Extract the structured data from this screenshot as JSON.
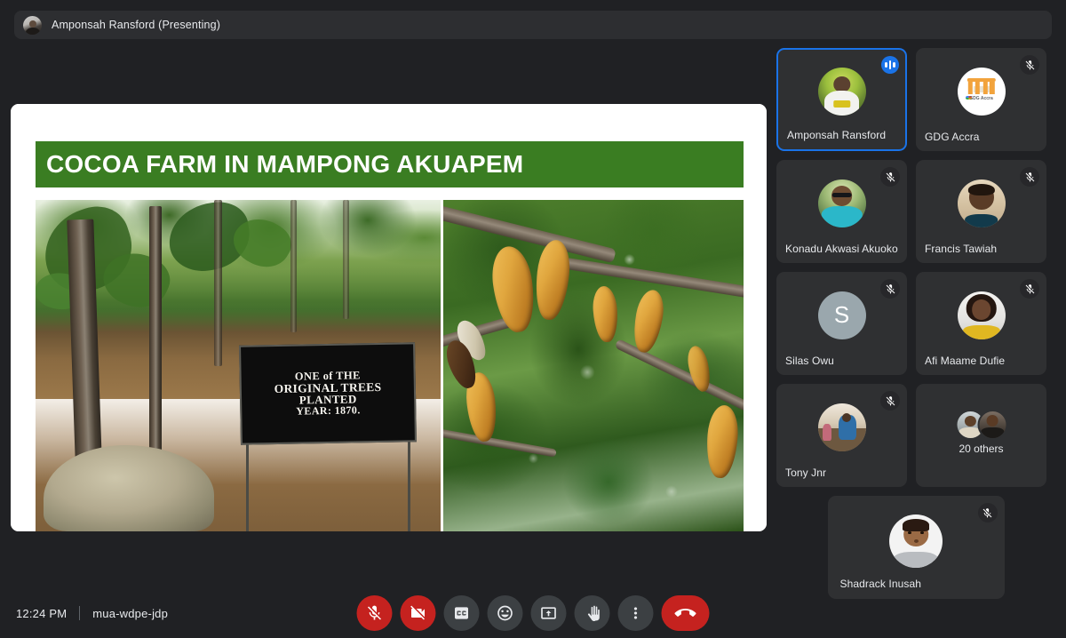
{
  "app": {
    "background_color": "#202124",
    "accent_color": "#1a73e8",
    "danger_color": "#c5221f"
  },
  "presenter_banner": {
    "label": "Amponsah Ransford (Presenting)",
    "avatar_name": "presenter-avatar"
  },
  "shared_screen": {
    "slide_title": "COCOA FARM IN MAMPONG AKUAPEM",
    "title_band_color": "#3a7d22",
    "photos": [
      {
        "name": "cocoa-farm-plaque-photo",
        "plaque_lines": [
          "ONE of THE",
          "ORIGINAL TREES",
          "PLANTED",
          "YEAR:  1870."
        ]
      },
      {
        "name": "cocoa-pods-photo",
        "description": "Cocoa pods on tree branches"
      }
    ]
  },
  "participants": [
    {
      "name": "Amponsah Ransford",
      "muted": false,
      "speaking": true,
      "active": true,
      "avatar": "av-ransford",
      "initial": ""
    },
    {
      "name": "GDG Accra",
      "muted": true,
      "speaking": false,
      "active": false,
      "avatar": "av-gdg",
      "initial": ""
    },
    {
      "name": "Konadu Akwasi Akuoko",
      "muted": true,
      "speaking": false,
      "active": false,
      "avatar": "av-konadu",
      "initial": ""
    },
    {
      "name": "Francis Tawiah",
      "muted": true,
      "speaking": false,
      "active": false,
      "avatar": "av-francis",
      "initial": ""
    },
    {
      "name": "Silas Owu",
      "muted": true,
      "speaking": false,
      "active": false,
      "avatar": "av-silas",
      "initial": "S"
    },
    {
      "name": "Afi Maame Dufie",
      "muted": true,
      "speaking": false,
      "active": false,
      "avatar": "av-afi",
      "initial": ""
    },
    {
      "name": "Tony Jnr",
      "muted": true,
      "speaking": false,
      "active": false,
      "avatar": "av-tony",
      "initial": ""
    },
    {
      "name": "20 others",
      "muted": false,
      "speaking": false,
      "active": false,
      "avatar": "av-others",
      "initial": ""
    },
    {
      "name": "Shadrack Inusah",
      "muted": true,
      "speaking": false,
      "active": false,
      "avatar": "av-shadrack",
      "initial": ""
    }
  ],
  "bottom_bar": {
    "time": "12:24 PM",
    "meeting_code": "mua-wdpe-jdp",
    "controls": [
      {
        "name": "microphone-off-button",
        "icon": "mic-off-icon",
        "style": "danger"
      },
      {
        "name": "camera-off-button",
        "icon": "camera-off-icon",
        "style": "danger"
      },
      {
        "name": "captions-button",
        "icon": "closed-caption-icon",
        "style": "normal"
      },
      {
        "name": "emoji-reactions-button",
        "icon": "emoji-icon",
        "style": "normal"
      },
      {
        "name": "present-screen-button",
        "icon": "present-icon",
        "style": "normal"
      },
      {
        "name": "raise-hand-button",
        "icon": "raise-hand-icon",
        "style": "normal"
      },
      {
        "name": "more-options-button",
        "icon": "more-vertical-icon",
        "style": "normal"
      },
      {
        "name": "end-call-button",
        "icon": "end-call-icon",
        "style": "endcall"
      }
    ]
  }
}
